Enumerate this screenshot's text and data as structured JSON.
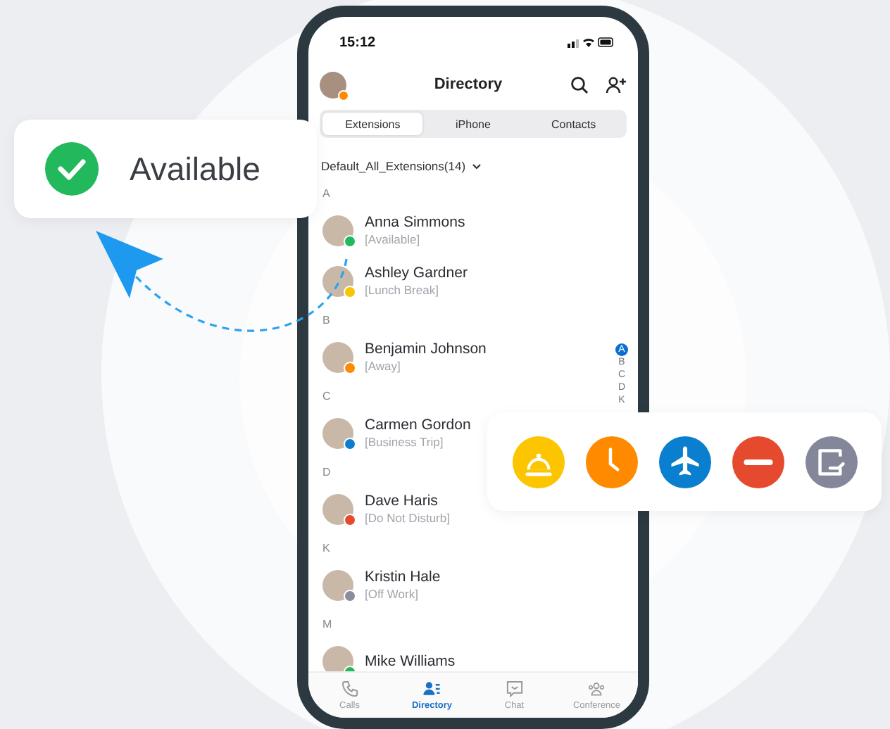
{
  "status_bar": {
    "time": "15:12"
  },
  "header": {
    "title": "Directory"
  },
  "segments": [
    {
      "label": "Extensions",
      "selected": true
    },
    {
      "label": "iPhone",
      "selected": false
    },
    {
      "label": "Contacts",
      "selected": false
    }
  ],
  "group_filter": {
    "label": "Default_All_Extensions(14)"
  },
  "sections": [
    {
      "letter": "A",
      "contacts": [
        {
          "name": "Anna Simmons",
          "status": "[Available]",
          "color": "#22b85c"
        },
        {
          "name": "Ashley Gardner",
          "status": "[Lunch Break]",
          "color": "#f9c400"
        }
      ]
    },
    {
      "letter": "B",
      "contacts": [
        {
          "name": "Benjamin Johnson",
          "status": "[Away]",
          "color": "#ff8a00"
        }
      ]
    },
    {
      "letter": "C",
      "contacts": [
        {
          "name": "Carmen Gordon",
          "status": "[Business Trip]",
          "color": "#0a7fd0"
        }
      ]
    },
    {
      "letter": "D",
      "contacts": [
        {
          "name": "Dave Haris",
          "status": "[Do Not Disturb]",
          "color": "#e64a2e"
        }
      ]
    },
    {
      "letter": "K",
      "contacts": [
        {
          "name": "Kristin Hale",
          "status": "[Off Work]",
          "color": "#8a8e9c"
        }
      ]
    },
    {
      "letter": "M",
      "contacts": [
        {
          "name": "Mike Williams",
          "color": "#22b85c"
        }
      ]
    }
  ],
  "index": [
    {
      "letter": "A",
      "selected": true
    },
    {
      "letter": "B",
      "selected": false
    },
    {
      "letter": "C",
      "selected": false
    },
    {
      "letter": "D",
      "selected": false
    },
    {
      "letter": "K",
      "selected": false
    }
  ],
  "tab_bar": [
    {
      "kind": "calls",
      "label": "Calls",
      "selected": false
    },
    {
      "kind": "directory",
      "label": "Directory",
      "selected": true
    },
    {
      "kind": "chat",
      "label": "Chat",
      "selected": false
    },
    {
      "kind": "conference",
      "label": "Conference",
      "selected": false
    }
  ],
  "status_callout": {
    "label": "Available"
  },
  "status_icons": [
    {
      "kind": "lunch",
      "color": "#fcc500"
    },
    {
      "kind": "away",
      "color": "#ff8a00"
    },
    {
      "kind": "trip",
      "color": "#0a7fd0"
    },
    {
      "kind": "dnd",
      "color": "#e64a2e"
    },
    {
      "kind": "off",
      "color": "#838799"
    }
  ]
}
